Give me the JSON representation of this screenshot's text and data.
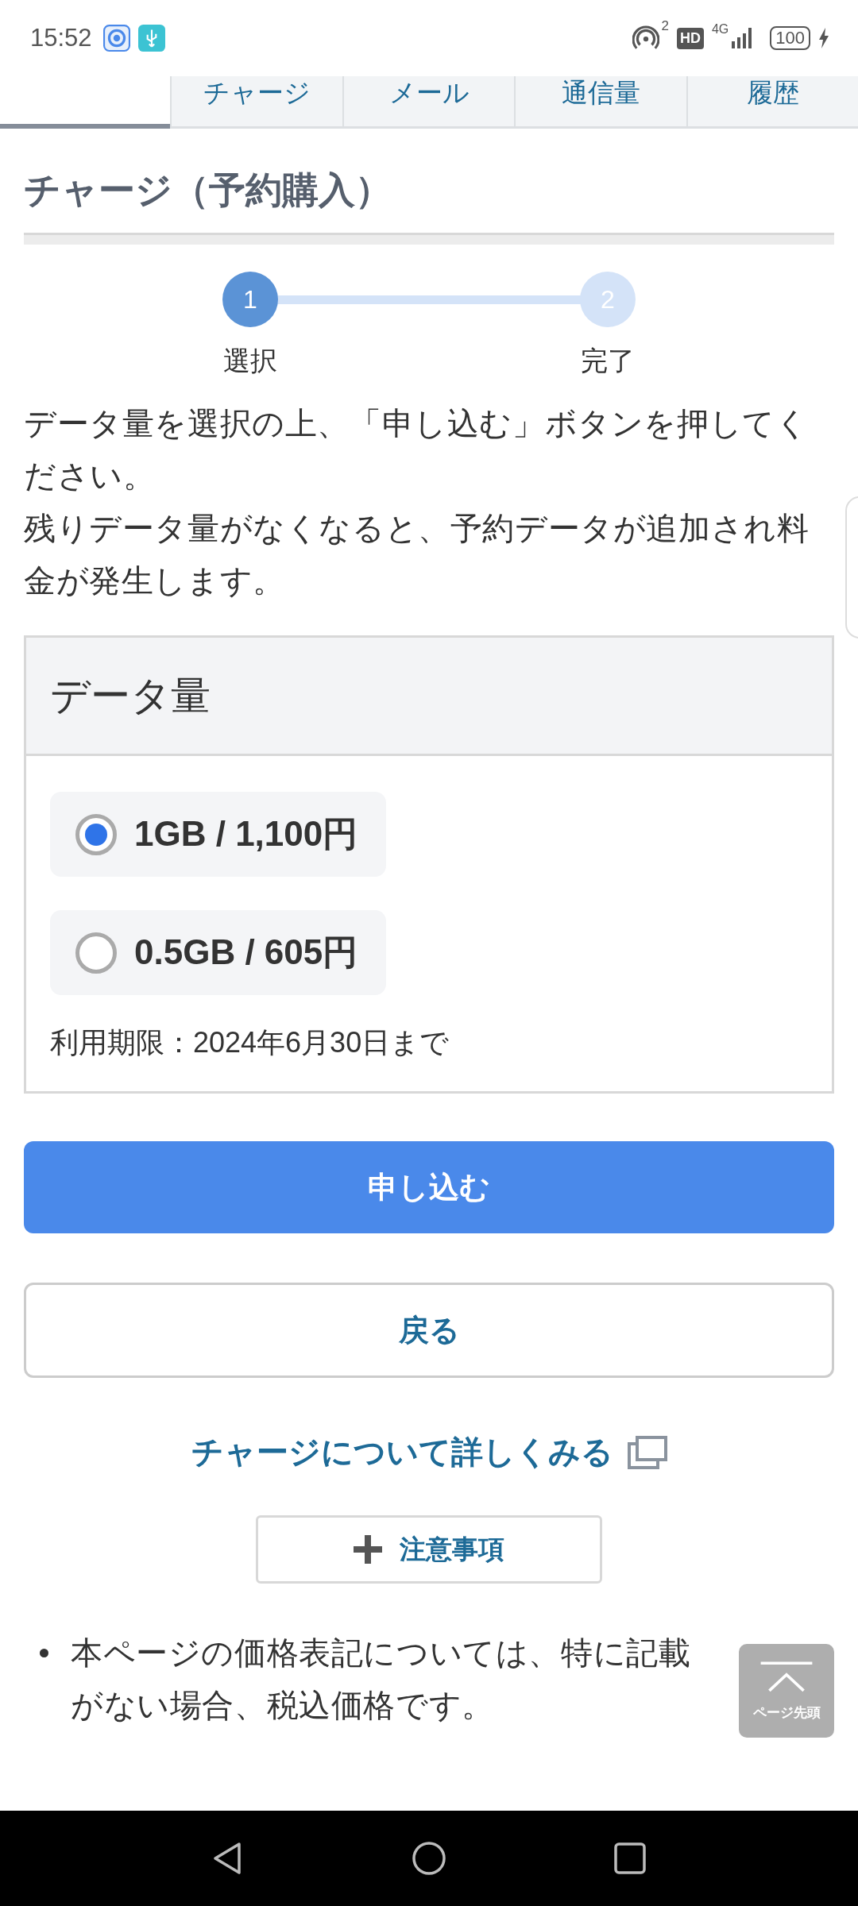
{
  "status_bar": {
    "time": "15:52",
    "hotspot_count": "2",
    "hd_badge": "HD",
    "network": "4G",
    "battery": "100"
  },
  "tabs": [
    {
      "selected": true
    },
    {
      "label": "チャージ",
      "selected": false
    },
    {
      "label": "メール",
      "selected": false
    },
    {
      "label": "通信量",
      "selected": false
    },
    {
      "label": "履歴",
      "selected": false
    }
  ],
  "page_title": "チャージ（予約購入）",
  "steps": [
    {
      "number": "1",
      "label": "選択",
      "current": true
    },
    {
      "number": "2",
      "label": "完了",
      "current": false
    }
  ],
  "instructions": [
    "データ量を選択の上、「申し込む」ボタンを押してください。",
    "残りデータ量がなくなると、予約データが追加され料金が発生します。"
  ],
  "data_panel": {
    "heading": "データ量",
    "options": [
      {
        "label": "1GB / 1,100円",
        "selected": true
      },
      {
        "label": "0.5GB / 605円",
        "selected": false
      }
    ],
    "expiry": "利用期限：2024年6月30日まで"
  },
  "apply_button": "申し込む",
  "back_button": "戻る",
  "details_link": "チャージについて詳しくみる",
  "notes_button": {
    "label": "注意事項",
    "expanded": false
  },
  "notes": [
    "本ページの価格表記については、特に記載がない場合、税込価格です。"
  ],
  "back_to_top": "ページ先頭"
}
